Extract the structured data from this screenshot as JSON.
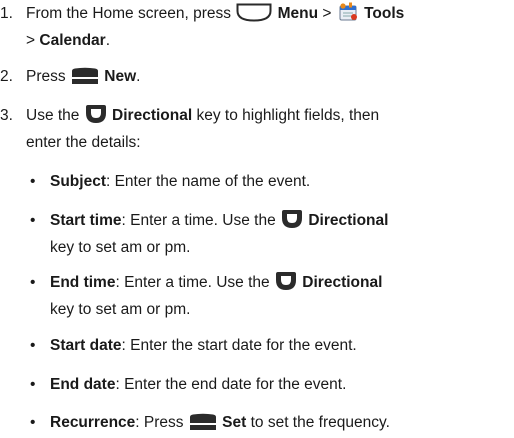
{
  "steps": [
    {
      "num": "1.",
      "line1_a": "From the Home screen, press",
      "menu": "Menu",
      "sep1": ">",
      "tools": "Tools",
      "sep2": ">",
      "calendar": "Calendar",
      "end": ".",
      "icons": [
        "menu-key-icon",
        "tools-app-icon"
      ]
    },
    {
      "num": "2.",
      "press": "Press",
      "new": "New",
      "end": ".",
      "icons": [
        "softkey-icon"
      ]
    },
    {
      "num": "3.",
      "use": "Use the",
      "directional": "Directional",
      "rest1": "key to highlight fields, then",
      "rest2": "enter the details:",
      "icons": [
        "directional-key-icon"
      ]
    }
  ],
  "bullets": [
    {
      "label": "Subject",
      "text": ": Enter the name of the event."
    },
    {
      "label": "Start time",
      "text1": ": Enter a time. Use the",
      "directional": "Directional",
      "text2": "key to set am or pm."
    },
    {
      "label": "End time",
      "text1": ": Enter a time. Use the",
      "directional": "Directional",
      "text2": "key to set am or pm."
    },
    {
      "label": "Start date",
      "text": ": Enter the start date for the event."
    },
    {
      "label": "End date",
      "text": ": Enter the end date for the event."
    },
    {
      "label": "Recurrence",
      "text1": ": Press",
      "set": "Set",
      "text2": "to set the frequency."
    }
  ],
  "bullet_char": "•"
}
